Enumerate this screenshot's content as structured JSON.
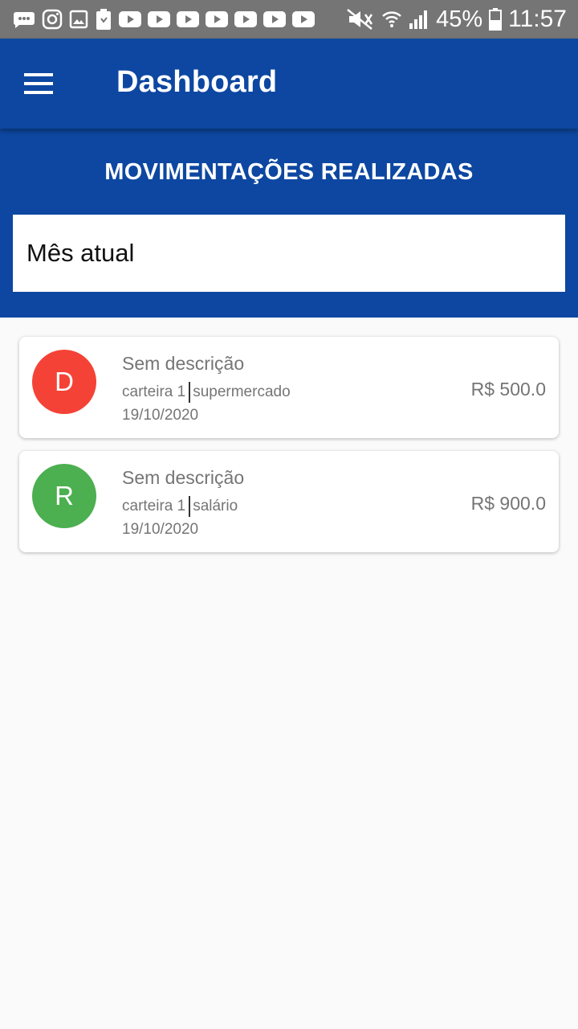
{
  "status_bar": {
    "battery": "45%",
    "time": "11:57",
    "icons": [
      "chat-icon",
      "instagram-icon",
      "gallery-icon",
      "battery-saver-icon",
      "youtube-icon",
      "youtube-icon",
      "youtube-icon",
      "youtube-icon",
      "youtube-icon",
      "youtube-icon",
      "youtube-icon",
      "mute-icon",
      "wifi-icon",
      "signal-icon",
      "battery-icon"
    ]
  },
  "app_bar": {
    "title": "Dashboard",
    "menu_icon": "hamburger-menu-icon"
  },
  "header": {
    "section_title": "MOVIMENTAÇÕES REALIZADAS",
    "period": "Mês atual"
  },
  "colors": {
    "primary": "#0d47a1",
    "expense": "#f44336",
    "income": "#4caf50",
    "status_bar": "#757575"
  },
  "transactions": [
    {
      "initial": "D",
      "description": "Sem descrição",
      "wallet": "carteira 1",
      "category": "supermercado",
      "date": "19/10/2020",
      "amount": "R$ 500.0"
    },
    {
      "initial": "R",
      "description": "Sem descrição",
      "wallet": "carteira 1",
      "category": "salário",
      "date": "19/10/2020",
      "amount": "R$ 900.0"
    }
  ]
}
